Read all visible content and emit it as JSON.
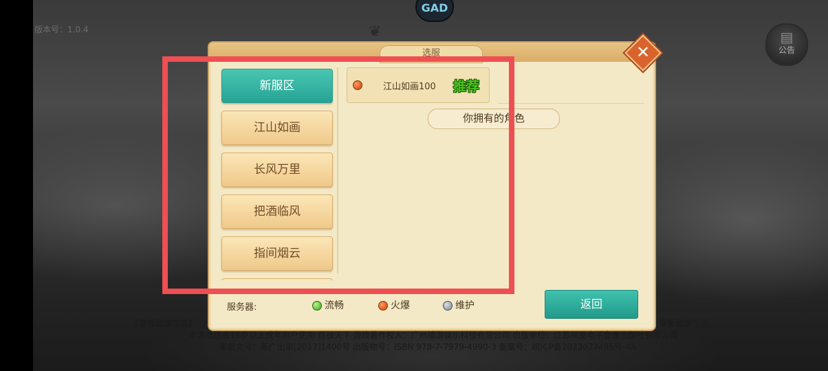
{
  "hud": {
    "version_text": "版本号：1.0.4",
    "logo_text": "GAD",
    "notice_label": "公告"
  },
  "dialog": {
    "title": "选服",
    "close_symbol": "✕",
    "tabs": [
      "新服区",
      "江山如画",
      "长风万里",
      "把酒临风",
      "指间烟云"
    ],
    "active_tab": "新服区",
    "server": {
      "name": "江山如画100",
      "status": "火爆",
      "badge": "推荐"
    },
    "roles_banner": "你拥有的角色",
    "legend": {
      "label": "服务器:",
      "items": [
        {
          "status": "smooth",
          "text": "流畅",
          "color": "#3aa81a"
        },
        {
          "status": "busy",
          "text": "火爆",
          "color": "#d23e0c"
        },
        {
          "status": "maintenance",
          "text": "维护",
          "color": "#7c8896"
        }
      ]
    },
    "return_label": "返回"
  },
  "footer": {
    "line1_left": "《游戏健康忠告》",
    "line1_right": "享受健康生活。",
    "line2": "本游戏适合16岁以上成年用户使用 百战天下 游戏著作权人：广州禧游娱乐科技有限公司 出版单位：江苏凤凰电子音像出版社有限公司",
    "line3": "审批文号：新广出审[2017]1400号 出版物号：ISBN 978-7-7979-4990-3        备案号：皖ICP备2023027495号-4A"
  },
  "colors": {
    "highlight_border": "#ef4f53",
    "accent_teal": "#27a394",
    "panel": "#f4e9c6"
  }
}
